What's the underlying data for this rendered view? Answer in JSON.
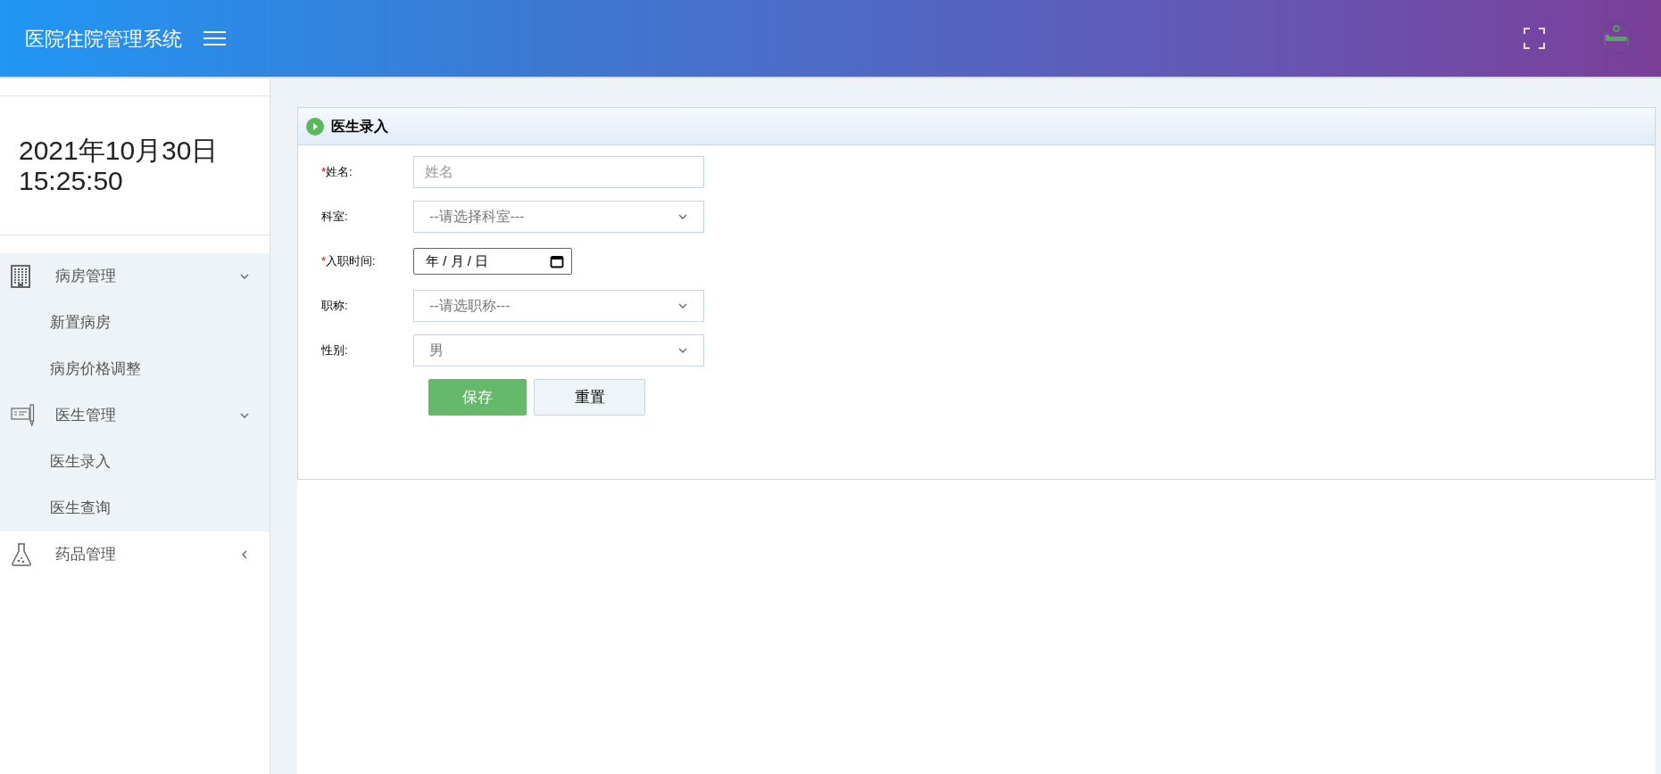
{
  "header": {
    "title": "医院住院管理系统"
  },
  "sidebar": {
    "date": "2021年10月30日",
    "time": "15:25:50",
    "menu": [
      {
        "label": "病房管理",
        "expanded": true,
        "children": [
          {
            "label": "新置病房"
          },
          {
            "label": "病房价格调整"
          }
        ]
      },
      {
        "label": "医生管理",
        "expanded": true,
        "children": [
          {
            "label": "医生录入"
          },
          {
            "label": "医生查询"
          }
        ]
      },
      {
        "label": "药品管理",
        "expanded": false
      }
    ]
  },
  "panel": {
    "title": "医生录入",
    "fields": [
      {
        "kind": "text",
        "label": "姓名:",
        "required_mark": "*",
        "placeholder": "姓名"
      },
      {
        "kind": "select",
        "label": "科室:",
        "value": "--请选择科室---"
      },
      {
        "kind": "date",
        "label": "入职时间:",
        "required_mark": "*",
        "parts": [
          "年",
          "/",
          "月",
          "/",
          "日"
        ]
      },
      {
        "kind": "select",
        "label": "职称:",
        "value": "--请选职称---"
      },
      {
        "kind": "select",
        "label": "性别:",
        "value": "男"
      }
    ],
    "buttons": [
      {
        "kind": "primary",
        "label": "保存"
      },
      {
        "kind": "secondary",
        "label": "重置"
      }
    ]
  }
}
